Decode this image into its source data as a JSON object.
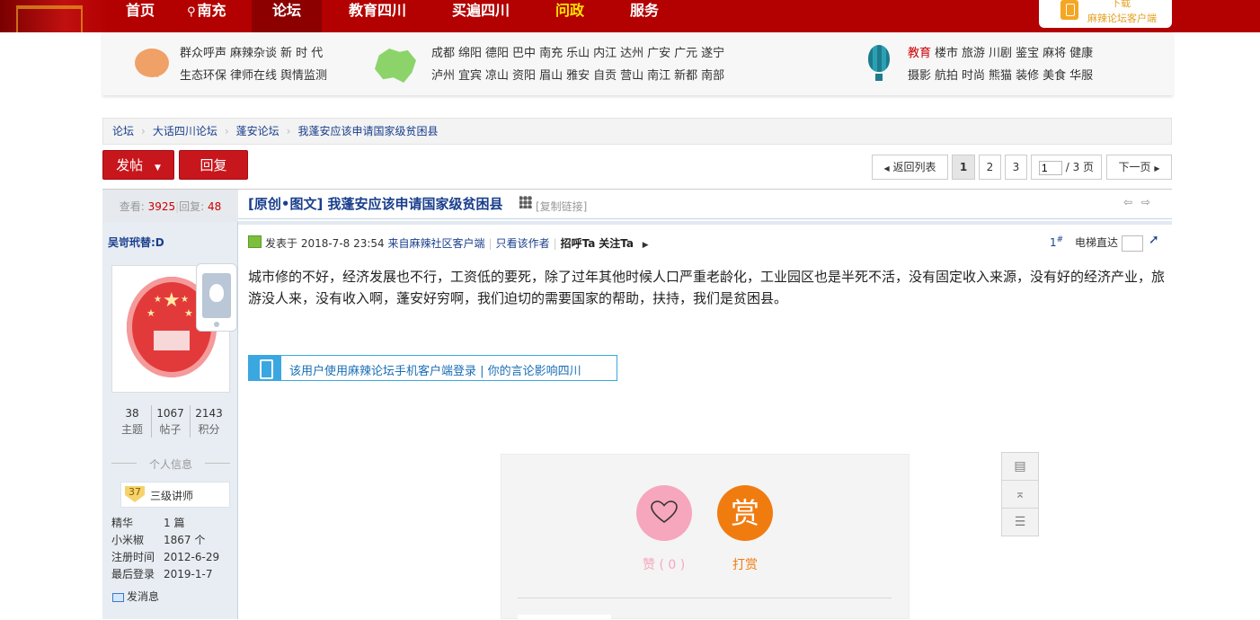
{
  "topnav": {
    "items": [
      "首页",
      "南充",
      "论坛",
      "教育四川",
      "买遍四川",
      "问政",
      "服务"
    ],
    "app_line1": "下载",
    "app_line2": "麻辣论坛客户端"
  },
  "catbar": {
    "group1": {
      "row1": [
        "群众呼声",
        "麻辣杂谈",
        "新 时 代"
      ],
      "row2": [
        "生态环保",
        "律师在线",
        "舆情监测"
      ]
    },
    "group2": {
      "row1": [
        "成都",
        "绵阳",
        "德阳",
        "巴中",
        "南充",
        "乐山",
        "内江",
        "达州",
        "广安",
        "广元",
        "遂宁"
      ],
      "row2": [
        "泸州",
        "宜宾",
        "凉山",
        "资阳",
        "眉山",
        "雅安",
        "自贡",
        "营山",
        "南江",
        "新都",
        "南部"
      ]
    },
    "group3": {
      "row1": [
        "教育",
        "楼市",
        "旅游",
        "川剧",
        "鉴宝",
        "麻将",
        "健康"
      ],
      "row2": [
        "摄影",
        "航拍",
        "时尚",
        "熊猫",
        "装修",
        "美食",
        "华服"
      ]
    }
  },
  "breadcrumb": [
    "论坛",
    "大话四川论坛",
    "蓬安论坛",
    "我蓬安应该申请国家级贫困县"
  ],
  "toolbar": {
    "post_label": "发帖",
    "reply_label": "回复",
    "back_label": "返回列表",
    "pages": [
      "1",
      "2",
      "3"
    ],
    "page_input": "1",
    "page_total": "/ 3 页",
    "next_label": "下一页"
  },
  "stats": {
    "views_label": "查看:",
    "views": "3925",
    "replies_label": "回复:",
    "replies": "48"
  },
  "author": {
    "name": "吴岢玳替:D",
    "topics": "38",
    "topics_label": "主题",
    "posts": "1067",
    "posts_label": "帖子",
    "points": "2143",
    "points_label": "积分",
    "section_label": "个人信息",
    "level_num": "37",
    "level_title": "三级讲师",
    "info": [
      {
        "k": "精华",
        "v": "1 篇"
      },
      {
        "k": "小米椒",
        "v": "1867 个"
      },
      {
        "k": "注册时间",
        "v": "2012-6-29"
      },
      {
        "k": "最后登录",
        "v": "2019-1-7"
      }
    ],
    "message_label": "发消息"
  },
  "post": {
    "title": "[原创•图文] 我蓬安应该申请国家级贫困县",
    "copy_link": "[复制链接]",
    "posted_at": "发表于 2018-7-8 23:54",
    "source": "来自麻辣社区客户端",
    "only_author": "只看该作者",
    "greet": "招呼Ta",
    "follow": "关注Ta",
    "floor": "1",
    "elevator_label": "电梯直达",
    "body": "城市修的不好，经济发展也不行，工资低的要死，除了过年其他时候人口严重老龄化，工业园区也是半死不活，没有固定收入来源，没有好的经济产业，旅游没人来，没有收入啊，蓬安好穷啊，我们迫切的需要国家的帮助，扶持，我们是贫困县。",
    "mobile_notice": "该用户使用麻辣论坛手机客户端登录  |  你的言论影响四川"
  },
  "reward": {
    "like_label": "赞 ( 0 )",
    "tip_glyph": "赏",
    "tip_label": "打赏"
  },
  "colors": {
    "brand_red": "#b30000",
    "link_blue": "#1a3f8c",
    "like_pink": "#f6a6bd",
    "tip_orange": "#f07c10"
  }
}
